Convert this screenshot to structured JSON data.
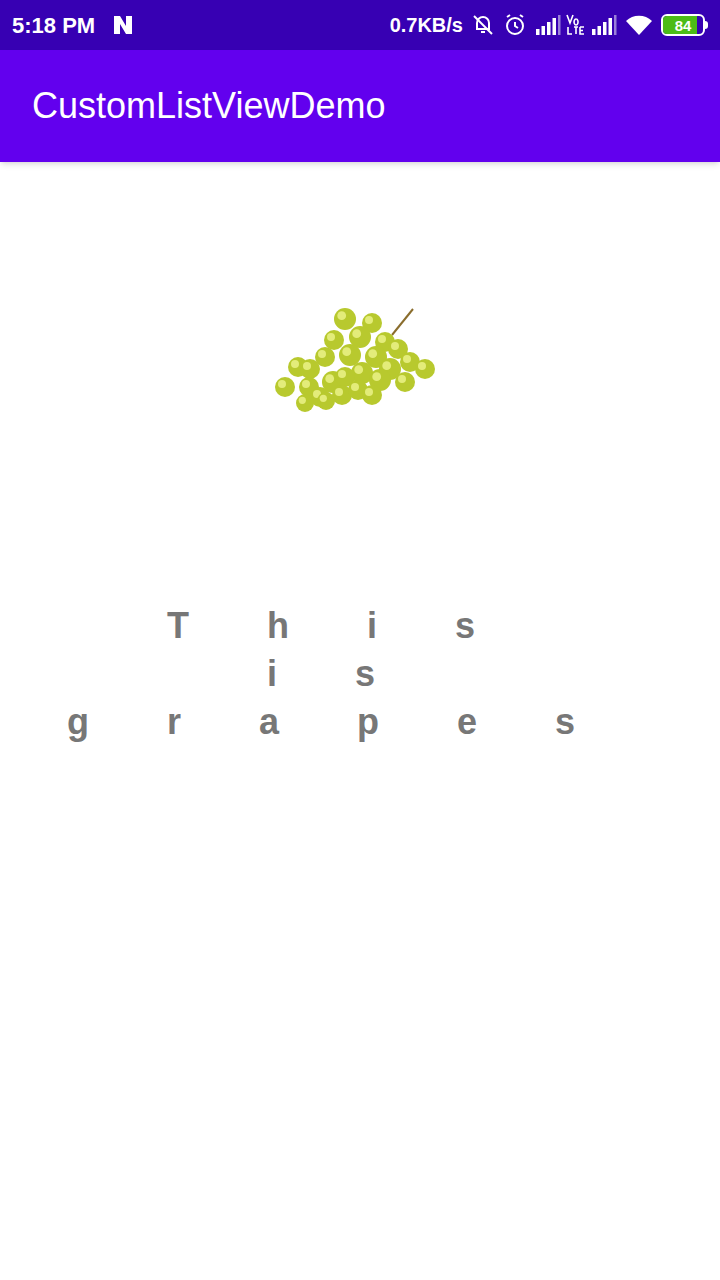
{
  "status_bar": {
    "time": "5:18 PM",
    "speed": "0.7KB/s",
    "battery": "84",
    "battery_level": 0.84
  },
  "app_bar": {
    "title": "CustomListViewDemo"
  },
  "item": {
    "caption": "This is grapes"
  }
}
